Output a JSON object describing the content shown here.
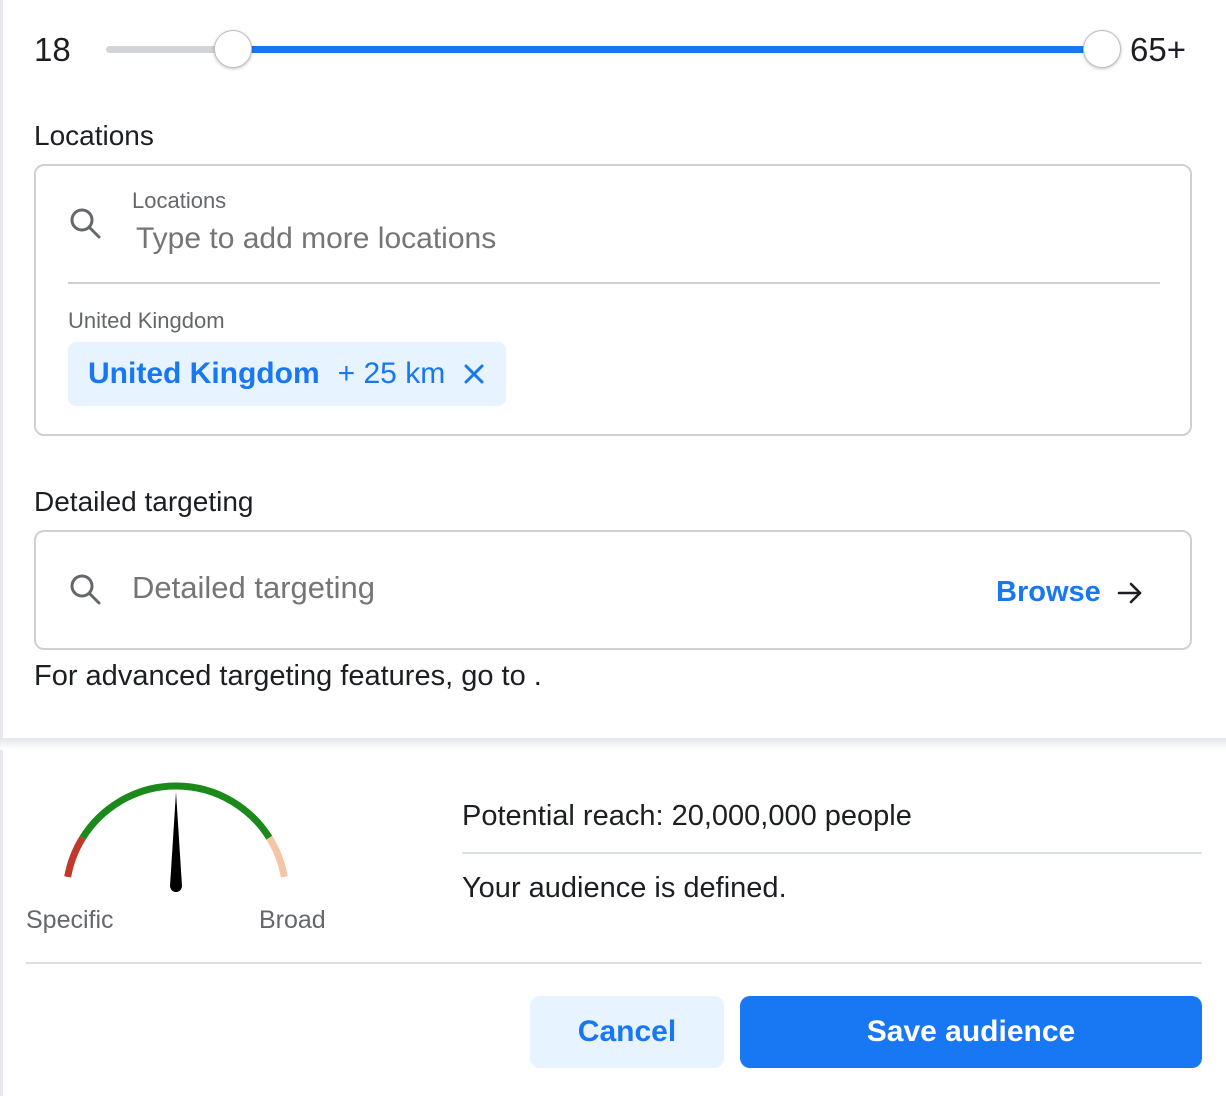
{
  "age": {
    "min_label": "18",
    "max_label": "65+",
    "range_min": 18,
    "range_max": 65,
    "selected_min": 24,
    "selected_max": 65
  },
  "locations": {
    "heading": "Locations",
    "field_label": "Locations",
    "placeholder": "Type to add more locations",
    "group_label": "United Kingdom",
    "chip": {
      "name": "United Kingdom",
      "radius": "+ 25 km"
    }
  },
  "detailed_targeting": {
    "heading": "Detailed targeting",
    "placeholder": "Detailed targeting",
    "browse_label": "Browse"
  },
  "advanced_note": "For advanced targeting features, go to .",
  "audience_gauge": {
    "specific_label": "Specific",
    "broad_label": "Broad",
    "needle_position": 0.5,
    "colors": {
      "specific": "#c0392b",
      "defined": "#1b8a1b",
      "broad": "#f5c6a5",
      "needle": "#000000"
    }
  },
  "reach": {
    "text": "Potential reach: 20,000,000 people",
    "status": "Your audience is defined."
  },
  "buttons": {
    "cancel": "Cancel",
    "save": "Save audience"
  },
  "theme": {
    "accent": "#1877f2",
    "accent_light": "#e7f3ff",
    "border": "#ced0d4",
    "muted_text": "#65676b"
  }
}
